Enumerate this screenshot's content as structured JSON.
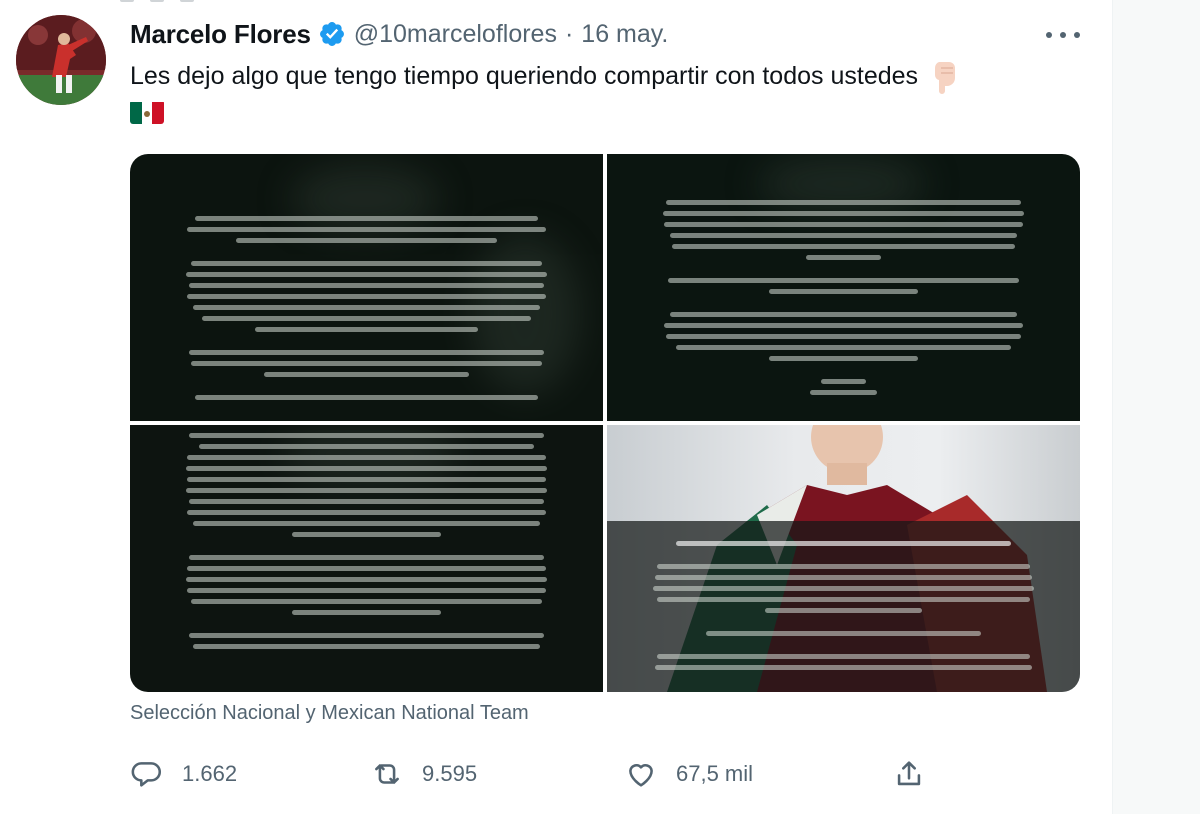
{
  "tweet": {
    "author_name": "Marcelo Flores",
    "handle": "@10marceloflores",
    "separator": "·",
    "date": "16 may.",
    "text": "Les dejo algo que tengo tiempo queriendo compartir con todos ustedes",
    "emoji_pointing": "pointing-down-icon",
    "emoji_flag": "mexico-flag-icon",
    "media_caption": "Selección Nacional y Mexican National Team",
    "verified_icon": "verified-badge-icon",
    "colors": {
      "verified": "#1d9bf0",
      "secondary_text": "#536471"
    }
  },
  "actions": {
    "reply_count": "1.662",
    "retweet_count": "9.595",
    "like_count": "67,5 mil"
  }
}
